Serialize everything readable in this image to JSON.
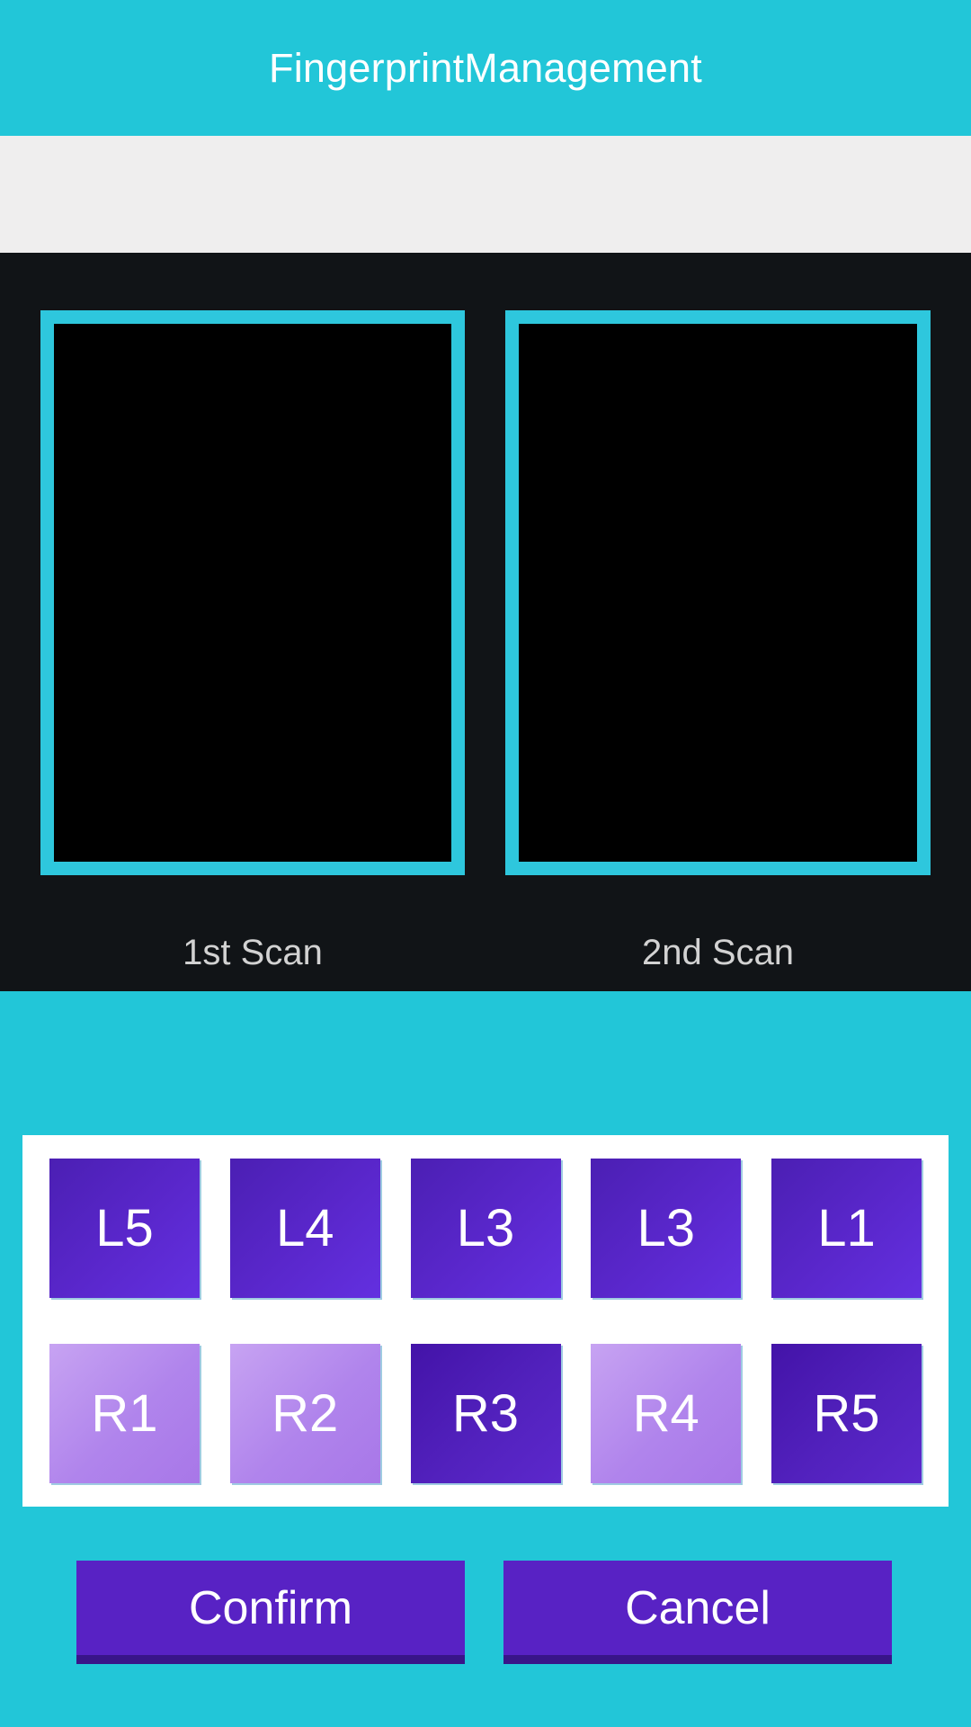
{
  "header": {
    "title": "FingerprintManagement",
    "background_color": "#22c6d8",
    "title_color": "#ffffff"
  },
  "spacer": {
    "background_color": "#efeeee"
  },
  "scan_section": {
    "background_color": "#111417",
    "border_color": "#2ec7dd",
    "frame_fill": "#000000",
    "label_color": "#d2d2d2",
    "scans": [
      {
        "label": "1st Scan",
        "image": ""
      },
      {
        "label": "2nd Scan",
        "image": ""
      }
    ]
  },
  "finger_panel": {
    "background_color": "#ffffff",
    "rows": [
      {
        "hand": "left",
        "buttons": [
          {
            "label": "L5",
            "state": "dark"
          },
          {
            "label": "L4",
            "state": "dark"
          },
          {
            "label": "L3",
            "state": "dark"
          },
          {
            "label": "L3",
            "state": "dark"
          },
          {
            "label": "L1",
            "state": "dark"
          }
        ]
      },
      {
        "hand": "right",
        "buttons": [
          {
            "label": "R1",
            "state": "light"
          },
          {
            "label": "R2",
            "state": "light"
          },
          {
            "label": "R3",
            "state": "deep"
          },
          {
            "label": "R4",
            "state": "light"
          },
          {
            "label": "R5",
            "state": "deep"
          }
        ]
      }
    ],
    "colors": {
      "dark": "#5a27cc",
      "light": "#b084ec",
      "deep": "#5221bd"
    }
  },
  "actions": {
    "confirm_label": "Confirm",
    "cancel_label": "Cancel",
    "button_color": "#5822c4",
    "shadow_color": "#391589",
    "text_color": "#ffffff"
  },
  "bottom_section": {
    "background_color": "#22c6d8"
  }
}
